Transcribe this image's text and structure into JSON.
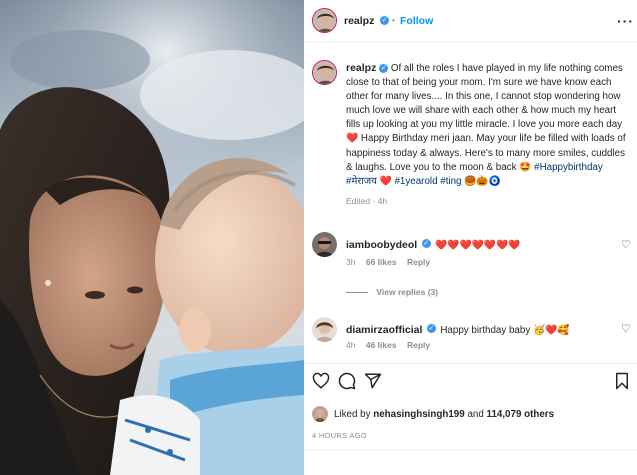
{
  "post": {
    "author": "realpz",
    "follow_label": "Follow",
    "more_icon": "more-horizontal-icon",
    "caption_text": "Of all the roles I have played in my life nothing comes close to that of being your mom. I'm sure we have know each other for many lives.... In this one, I cannot stop wondering how much love we will share with each other & how much my heart fills up looking at you my little miracle. I love you more each day ❤️ Happy Birthday meri jaan. May your life be filled with loads of happiness today & always. Here's to many more smiles, cuddles & laughs. Love you to the moon & back 🤩",
    "caption_tag1": "#Happybirthday",
    "caption_tag2": "#मेराजय",
    "caption_heart": "❤️",
    "caption_tag3": "#1yearold",
    "caption_tag4": "#ting",
    "caption_emojis": "🥮🎃🧿",
    "caption_meta": "Edited · 4h"
  },
  "comments": [
    {
      "user": "iamboobydeol",
      "text": "❤️❤️❤️❤️❤️❤️❤️",
      "time": "3h",
      "likes": "66 likes",
      "reply": "Reply",
      "view_replies": "View replies (3)"
    },
    {
      "user": "diamirzaofficial",
      "text": "Happy birthday baby 🥳❤️🥰",
      "time": "4h",
      "likes": "46 likes",
      "reply": "Reply"
    }
  ],
  "likes_line": {
    "prefix": "Liked by",
    "user": "nehasinghsingh199",
    "middle": "and",
    "count": "114,079 others"
  },
  "timestamp": "4 HOURS AGO",
  "colors": {
    "accent": "#0095f6",
    "verified": "#3897f0",
    "heart": "#ed4956",
    "muted": "#8e8e8e"
  }
}
